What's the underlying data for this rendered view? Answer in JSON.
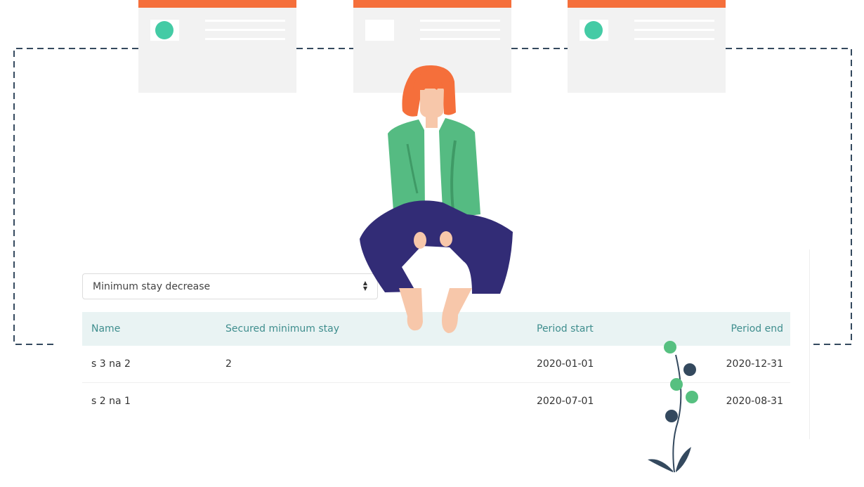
{
  "filter": {
    "selected": "Minimum stay decrease"
  },
  "table": {
    "headers": [
      "Name",
      "Secured minimum stay",
      "Period start",
      "Period end"
    ],
    "rows": [
      [
        "s 3 na 2",
        "2",
        "2020-01-01",
        "2020-12-31"
      ],
      [
        "s 2 na 1",
        "",
        "2020-07-01",
        "2020-08-31"
      ]
    ]
  },
  "colors": {
    "accent_orange": "#f56f3b",
    "card_gray": "#f2f2f2",
    "teal_dot": "#44cba5",
    "green_dot": "#56c080",
    "navy": "#34495e",
    "jacket": "#55bb82",
    "pants": "#322c76",
    "skin": "#f7c7aa",
    "header_bg": "#e9f3f3",
    "header_text": "#3f8e8e"
  },
  "icons": [
    "select-arrows-icon",
    "plant-illustration",
    "woman-illustration",
    "card-illustration"
  ]
}
